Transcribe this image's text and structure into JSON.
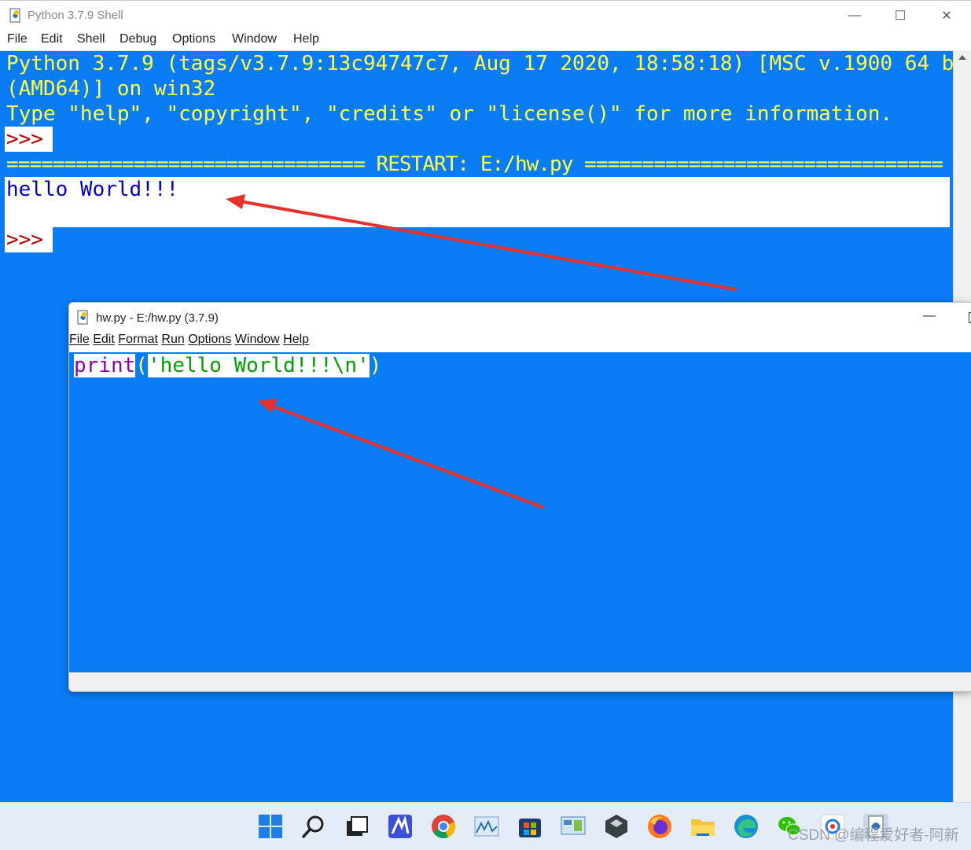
{
  "shell": {
    "title": "Python 3.7.9 Shell",
    "menu": [
      "File",
      "Edit",
      "Shell",
      "Debug",
      "Options",
      "Window",
      "Help"
    ],
    "banner_line1": "Python 3.7.9 (tags/v3.7.9:13c94747c7, Aug 17 2020, 18:58:18) [MSC v.1900 64 bit",
    "banner_line2": "(AMD64)] on win32",
    "banner_line3": "Type \"help\", \"copyright\", \"credits\" or \"license()\" for more information.",
    "prompt": ">>>",
    "restart_line": "=============================== RESTART: E:/hw.py ===============================",
    "output": "hello World!!!",
    "prompt2": ">>>"
  },
  "editor": {
    "title": "hw.py - E:/hw.py (3.7.9)",
    "menu": [
      "File",
      "Edit",
      "Format",
      "Run",
      "Options",
      "Window",
      "Help"
    ],
    "code": {
      "keyword": "print",
      "open_paren": "(",
      "string": "'hello World!!!\\n'",
      "close_paren": ")"
    }
  },
  "window_controls": {
    "minimize": "—",
    "maximize": "☐",
    "close": "✕"
  },
  "taskbar": {
    "icons": [
      "windows-start-icon",
      "search-icon",
      "task-view-icon",
      "app-icon",
      "chrome-icon",
      "photos-icon",
      "store-icon",
      "control-panel-icon",
      "app-cube-icon",
      "firefox-icon",
      "file-explorer-icon",
      "edge-icon",
      "wechat-icon",
      "app-icon",
      "python-icon"
    ]
  },
  "watermark": "CSDN @编程爱好者-阿新",
  "colors": {
    "background": "#0a7cf5",
    "banner_text": "#ffff44",
    "prompt": "#b00000",
    "output": "#0000d0",
    "keyword": "#8b00a8",
    "string": "#00a000",
    "arrow": "#e8302a"
  }
}
